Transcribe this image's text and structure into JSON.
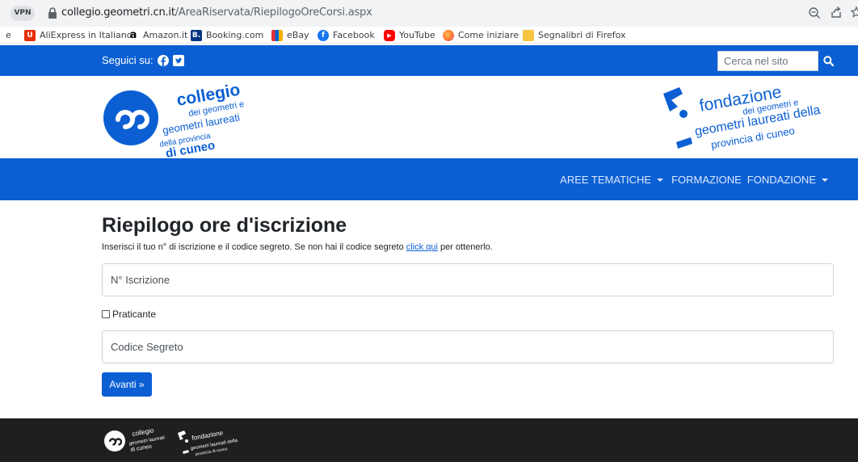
{
  "browser": {
    "vpn_label": "VPN",
    "url_domain": "collegio.geometri.cn.it",
    "url_path": "/AreaRiservata/RiepilogoOreCorsi.aspx"
  },
  "bookmarks": {
    "items": [
      {
        "label": "AliExpress in Italiano",
        "icon": "aliexpress-icon",
        "color": "#e62e04"
      },
      {
        "label": "Amazon.it",
        "icon": "amazon-icon",
        "color": "#000000"
      },
      {
        "label": "Booking.com",
        "icon": "booking-icon",
        "color": "#003580"
      },
      {
        "label": "eBay",
        "icon": "ebay-icon",
        "color": "#e53238"
      },
      {
        "label": "Facebook",
        "icon": "facebook-icon",
        "color": "#1877f2"
      },
      {
        "label": "YouTube",
        "icon": "youtube-icon",
        "color": "#ff0000"
      },
      {
        "label": "Come iniziare",
        "icon": "firefox-icon",
        "color": "#ff7139"
      },
      {
        "label": "Segnalibri di Firefox",
        "icon": "folder-icon",
        "color": "#f5c542"
      }
    ]
  },
  "topbar": {
    "follow_label": "Seguici su:",
    "search_placeholder": "Cerca nel sito"
  },
  "logos": {
    "collegio_lines": [
      "collegio",
      "dei geometri e",
      "geometri laureati",
      "della provincia",
      "di cuneo"
    ],
    "fondazione_lines": [
      "fondazione",
      "dei geometri e",
      "geometri laureati della",
      "provincia di cuneo"
    ]
  },
  "nav": {
    "items": [
      {
        "label": "AREE TEMATICHE",
        "dropdown": true
      },
      {
        "label": "FORMAZIONE",
        "dropdown": false
      },
      {
        "label": "FONDAZIONE",
        "dropdown": true
      }
    ]
  },
  "main": {
    "title": "Riepilogo ore d'iscrizione",
    "intro_before": "Inserisci il tuo n° di iscrizione e il codice segreto. Se non hai il codice segreto ",
    "intro_link": "click qui",
    "intro_after": " per ottenerlo.",
    "iscrizione_placeholder": "N° Iscrizione",
    "praticante_label": "Praticante",
    "codice_placeholder": "Codice Segreto",
    "submit_label": "Avanti »"
  },
  "colors": {
    "brand_blue": "#0b5fd3",
    "footer_dark": "#1f1f1f"
  }
}
